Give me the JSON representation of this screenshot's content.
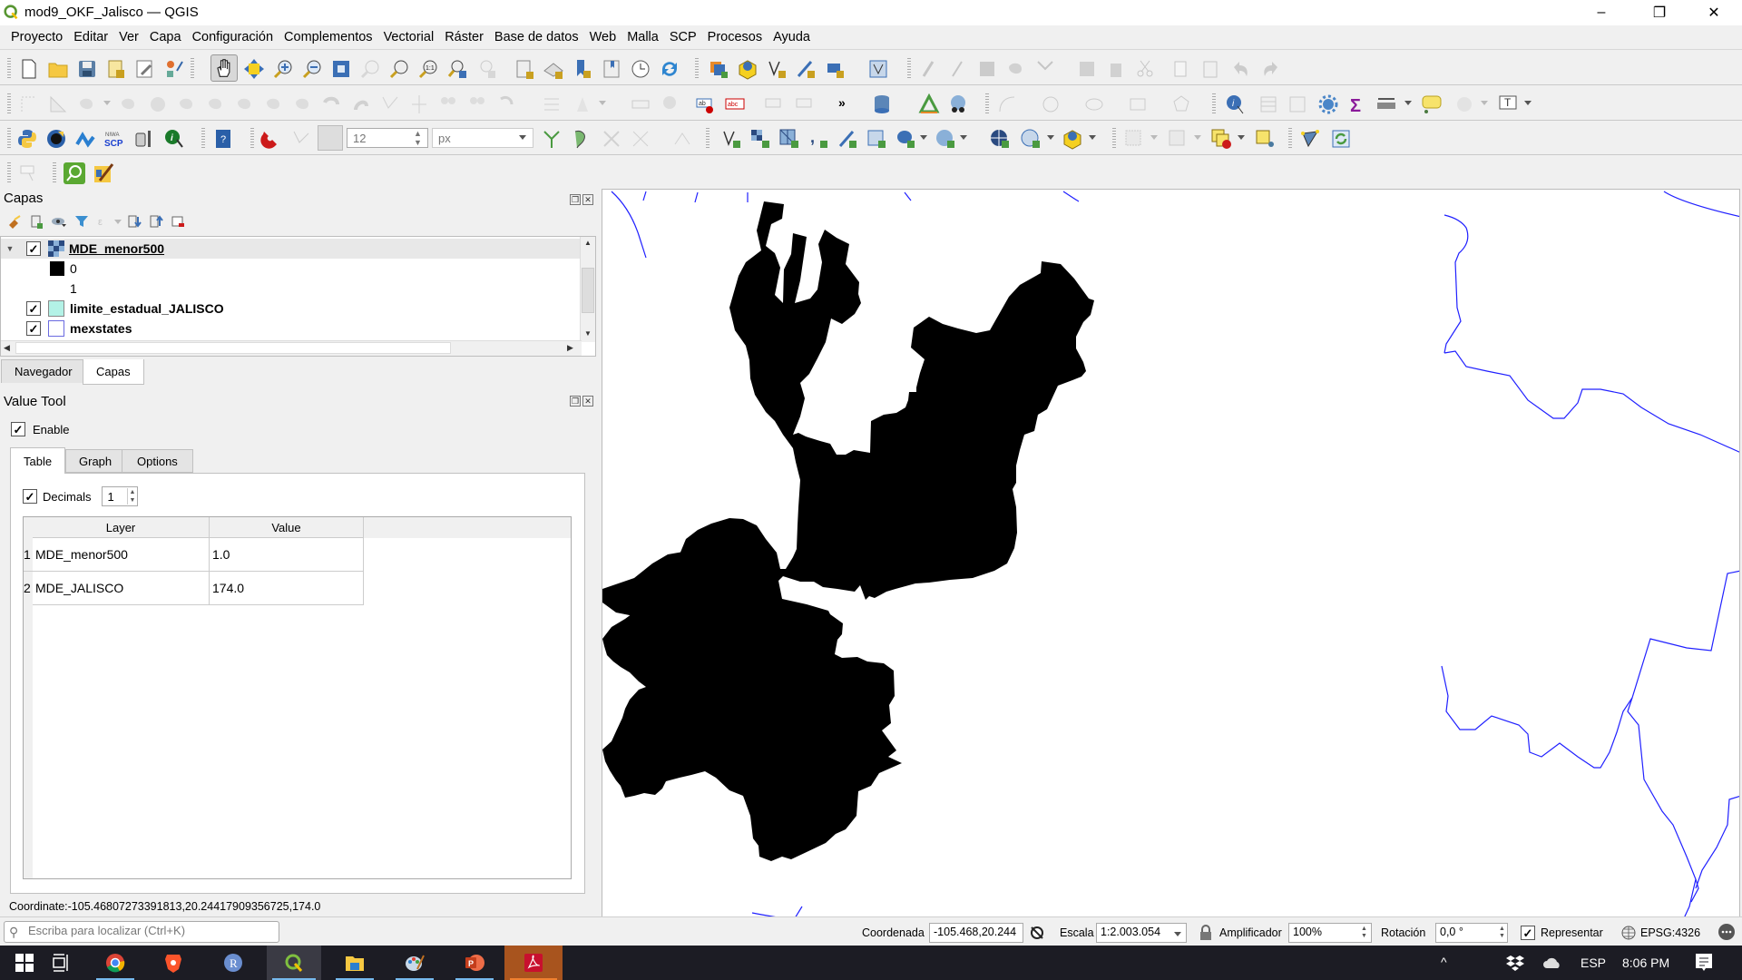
{
  "window": {
    "title": "mod9_OKF_Jalisco — QGIS",
    "controls": {
      "minimize": "–",
      "maximize": "❐",
      "close": "✕"
    }
  },
  "menu": [
    "Proyecto",
    "Editar",
    "Ver",
    "Capa",
    "Configuración",
    "Complementos",
    "Vectorial",
    "Ráster",
    "Base de datos",
    "Web",
    "Malla",
    "SCP",
    "Procesos",
    "Ayuda"
  ],
  "toolbars": {
    "snapping_tolerance": "12",
    "snapping_units": "px",
    "nav_icons": [
      "new-project-icon",
      "open-project-icon",
      "save-project-icon",
      "new-print-layout-icon",
      "layout-manager-icon",
      "style-manager-icon",
      "pan-icon",
      "pan-to-selection-icon",
      "zoom-in-icon",
      "zoom-out-icon",
      "zoom-full-icon",
      "zoom-to-selection-icon",
      "zoom-to-layer-icon",
      "zoom-native-icon",
      "zoom-last-icon",
      "zoom-next-icon",
      "new-map-view-icon",
      "new-3d-map-view-icon",
      "new-bookmark-icon",
      "show-bookmarks-icon",
      "temporal-controller-icon",
      "refresh-icon"
    ],
    "plugin_icons": [
      "python-console-icon",
      "qgis-plugin-icon",
      "network-plugin-icon",
      "scp-icon",
      "toolbox-robot-icon",
      "identify-plugin-icon",
      "help-icon",
      "snapping-magnet-icon"
    ]
  },
  "layers_panel": {
    "title": "Capas",
    "layers": [
      {
        "name": "MDE_menor500",
        "checked": true,
        "expanded": true,
        "type": "raster",
        "legend": [
          {
            "label": "0",
            "color": "#000000"
          },
          {
            "label": "1",
            "color": "#ffffff"
          }
        ]
      },
      {
        "name": "limite_estadual_JALISCO",
        "checked": true,
        "type": "polygon",
        "color": "#b3f2e6"
      },
      {
        "name": "mexstates",
        "checked": true,
        "type": "polygon",
        "color": "#ffffff"
      }
    ],
    "tabs": [
      "Navegador",
      "Capas"
    ],
    "active_tab": "Capas"
  },
  "value_tool": {
    "title": "Value Tool",
    "enable_label": "Enable",
    "enabled": true,
    "tabs": [
      "Table",
      "Graph",
      "Options"
    ],
    "active_tab": "Table",
    "decimals_label": "Decimals",
    "decimals_checked": true,
    "decimals_value": "1",
    "table": {
      "columns": [
        "Layer",
        "Value"
      ],
      "rows": [
        {
          "index": "1",
          "layer": "MDE_menor500",
          "value": "1.0"
        },
        {
          "index": "2",
          "layer": "MDE_JALISCO",
          "value": "174.0"
        }
      ]
    },
    "coordinate": "Coordinate:-105.46807273391813,20.24417909356725,174.0"
  },
  "map": {
    "raster_color": "#000000",
    "boundary_color": "#2020ff",
    "background": "#ffffff"
  },
  "statusbar": {
    "locator_placeholder": "Escriba para localizar (Ctrl+K)",
    "coord_label": "Coordenada",
    "coord_value": "-105.468,20.244",
    "scale_label": "Escala",
    "scale_value": "1:2.003.054",
    "magnifier_label": "Amplificador",
    "magnifier_value": "100%",
    "rotation_label": "Rotación",
    "rotation_value": "0,0 °",
    "render_label": "Representar",
    "render_checked": true,
    "crs": "EPSG:4326"
  },
  "taskbar": {
    "apps": [
      "windows-start-icon",
      "task-view-icon",
      "chrome-icon",
      "brave-icon",
      "r-icon",
      "qgis-icon",
      "file-explorer-icon",
      "paint-icon",
      "powerpoint-icon",
      "acrobat-icon"
    ],
    "language": "ESP",
    "time": "8:06 PM"
  }
}
